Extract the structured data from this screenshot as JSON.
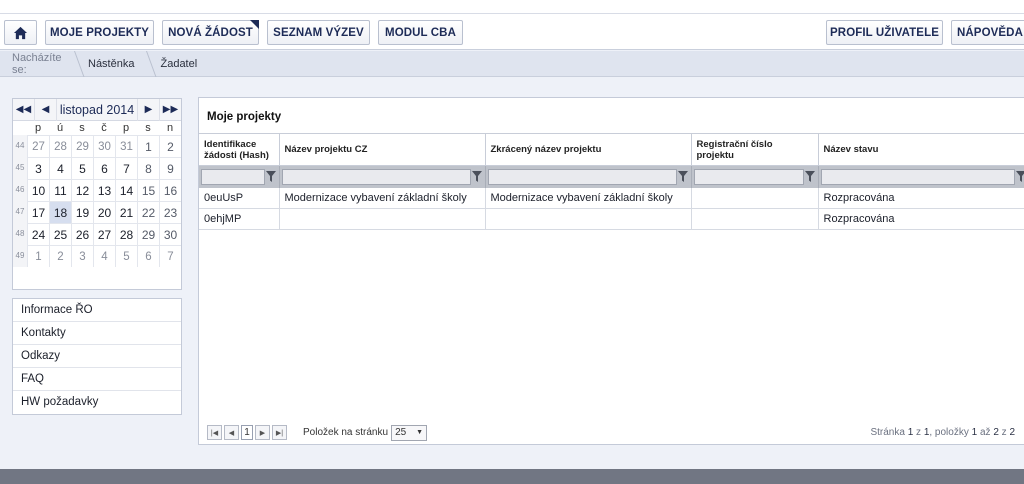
{
  "nav": {
    "home_icon": "home-icon",
    "buttons": [
      "MOJE PROJEKTY",
      "NOVÁ ŽÁDOST",
      "SEZNAM VÝZEV",
      "MODUL CBA"
    ],
    "right_buttons": [
      "PROFIL UŽIVATELE",
      "NÁPOVĚDA"
    ]
  },
  "breadcrumb": {
    "label": "Nacházíte se:",
    "items": [
      "Nástěnka",
      "Žadatel"
    ]
  },
  "calendar": {
    "month_label": "listopad 2014",
    "weekdays": [
      "p",
      "ú",
      "s",
      "č",
      "p",
      "s",
      "n"
    ],
    "weeks": [
      {
        "num": "44",
        "days": [
          "27",
          "28",
          "29",
          "30",
          "31",
          "1",
          "2"
        ]
      },
      {
        "num": "45",
        "days": [
          "3",
          "4",
          "5",
          "6",
          "7",
          "8",
          "9"
        ]
      },
      {
        "num": "46",
        "days": [
          "10",
          "11",
          "12",
          "13",
          "14",
          "15",
          "16"
        ]
      },
      {
        "num": "47",
        "days": [
          "17",
          "18",
          "19",
          "20",
          "21",
          "22",
          "23"
        ]
      },
      {
        "num": "48",
        "days": [
          "24",
          "25",
          "26",
          "27",
          "28",
          "29",
          "30"
        ]
      },
      {
        "num": "49",
        "days": [
          "1",
          "2",
          "3",
          "4",
          "5",
          "6",
          "7"
        ]
      }
    ],
    "today": "18"
  },
  "sidemenu": [
    "Informace ŘO",
    "Kontakty",
    "Odkazy",
    "FAQ",
    "HW požadavky"
  ],
  "projects": {
    "title": "Moje projekty",
    "columns": [
      "Identifikace žádosti (Hash)",
      "Název projektu CZ",
      "Zkrácený název projektu",
      "Registrační číslo projektu",
      "Název stavu"
    ],
    "rows": [
      [
        "0euUsP",
        "Modernizace vybavení základní školy",
        "Modernizace vybavení základní školy",
        "",
        "Rozpracována"
      ],
      [
        "0ehjMP",
        "",
        "",
        "",
        "Rozpracována"
      ]
    ]
  },
  "pager": {
    "page": "1",
    "per_page_label": "Položek na stránku",
    "per_page": "25",
    "info_prefix": "Stránka",
    "page_current": "1",
    "of": "z",
    "page_total": "1",
    "items_label": ", položky",
    "item_from": "1",
    "to": "až",
    "item_to": "2",
    "item_total": "2"
  },
  "colors": {
    "accent": "#1d2b57",
    "background": "#eef1f8",
    "footer": "#717683"
  }
}
